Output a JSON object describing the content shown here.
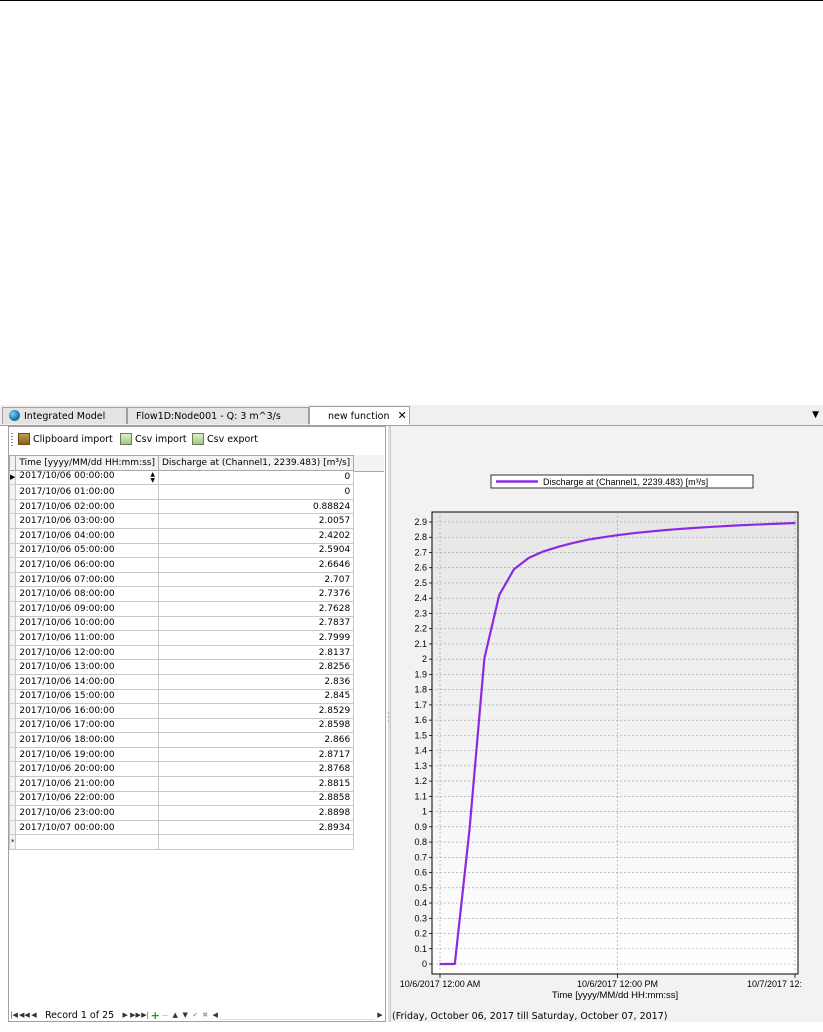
{
  "tabs": [
    {
      "label": "Integrated Model",
      "icon": "globe-icon",
      "active": false
    },
    {
      "label": "Flow1D:Node001 - Q: 3 m^3/s",
      "active": false
    },
    {
      "label": "new function",
      "active": true
    }
  ],
  "tab_close": "✕",
  "tab_menu": "▼",
  "toolbar": {
    "clipboard_import": "Clipboard import",
    "csv_import": "Csv import",
    "csv_export": "Csv export"
  },
  "table": {
    "columns": [
      "Time [yyyy/MM/dd HH:mm:ss]",
      "Discharge at (Channel1, 2239.483) [m³/s]"
    ],
    "rows": [
      [
        "2017/10/06 00:00:00",
        "0"
      ],
      [
        "2017/10/06 01:00:00",
        "0"
      ],
      [
        "2017/10/06 02:00:00",
        "0.88824"
      ],
      [
        "2017/10/06 03:00:00",
        "2.0057"
      ],
      [
        "2017/10/06 04:00:00",
        "2.4202"
      ],
      [
        "2017/10/06 05:00:00",
        "2.5904"
      ],
      [
        "2017/10/06 06:00:00",
        "2.6646"
      ],
      [
        "2017/10/06 07:00:00",
        "2.707"
      ],
      [
        "2017/10/06 08:00:00",
        "2.7376"
      ],
      [
        "2017/10/06 09:00:00",
        "2.7628"
      ],
      [
        "2017/10/06 10:00:00",
        "2.7837"
      ],
      [
        "2017/10/06 11:00:00",
        "2.7999"
      ],
      [
        "2017/10/06 12:00:00",
        "2.8137"
      ],
      [
        "2017/10/06 13:00:00",
        "2.8256"
      ],
      [
        "2017/10/06 14:00:00",
        "2.836"
      ],
      [
        "2017/10/06 15:00:00",
        "2.845"
      ],
      [
        "2017/10/06 16:00:00",
        "2.8529"
      ],
      [
        "2017/10/06 17:00:00",
        "2.8598"
      ],
      [
        "2017/10/06 18:00:00",
        "2.866"
      ],
      [
        "2017/10/06 19:00:00",
        "2.8717"
      ],
      [
        "2017/10/06 20:00:00",
        "2.8768"
      ],
      [
        "2017/10/06 21:00:00",
        "2.8815"
      ],
      [
        "2017/10/06 22:00:00",
        "2.8858"
      ],
      [
        "2017/10/06 23:00:00",
        "2.8898"
      ],
      [
        "2017/10/07 00:00:00",
        "2.8934"
      ]
    ],
    "new_row_marker": "*",
    "current_row_marker": "▶"
  },
  "navigator": {
    "record_text": "Record 1 of 25"
  },
  "status_text": "(Friday, October 06, 2017 till Saturday, October 07, 2017)",
  "chart_data": {
    "type": "line",
    "series": [
      {
        "name": "Discharge at (Channel1, 2239.483) [m³/s]",
        "color": "#8a2be2",
        "x": [
          "2017-10-06 00:00",
          "2017-10-06 01:00",
          "2017-10-06 02:00",
          "2017-10-06 03:00",
          "2017-10-06 04:00",
          "2017-10-06 05:00",
          "2017-10-06 06:00",
          "2017-10-06 07:00",
          "2017-10-06 08:00",
          "2017-10-06 09:00",
          "2017-10-06 10:00",
          "2017-10-06 11:00",
          "2017-10-06 12:00",
          "2017-10-06 13:00",
          "2017-10-06 14:00",
          "2017-10-06 15:00",
          "2017-10-06 16:00",
          "2017-10-06 17:00",
          "2017-10-06 18:00",
          "2017-10-06 19:00",
          "2017-10-06 20:00",
          "2017-10-06 21:00",
          "2017-10-06 22:00",
          "2017-10-06 23:00",
          "2017-10-07 00:00"
        ],
        "values": [
          0,
          0,
          0.88824,
          2.0057,
          2.4202,
          2.5904,
          2.6646,
          2.707,
          2.7376,
          2.7628,
          2.7837,
          2.7999,
          2.8137,
          2.8256,
          2.836,
          2.845,
          2.8529,
          2.8598,
          2.866,
          2.8717,
          2.8768,
          2.8815,
          2.8858,
          2.8898,
          2.8934
        ]
      }
    ],
    "xlabel": "Time [yyyy/MM/dd HH:mm:ss]",
    "ylabel": "",
    "ylim": [
      0,
      2.9
    ],
    "y_ticks": [
      "0",
      "0.1",
      "0.2",
      "0.3",
      "0.4",
      "0.5",
      "0.6",
      "0.7",
      "0.8",
      "0.9",
      "1",
      "1.1",
      "1.2",
      "1.3",
      "1.4",
      "1.5",
      "1.6",
      "1.7",
      "1.8",
      "1.9",
      "2",
      "2.1",
      "2.2",
      "2.3",
      "2.4",
      "2.5",
      "2.6",
      "2.7",
      "2.8",
      "2.9"
    ],
    "x_ticks": [
      "10/6/2017 12:00 AM",
      "10/6/2017 12:00 PM",
      "10/7/2017 12:"
    ],
    "grid": true,
    "legend_position": "top"
  }
}
